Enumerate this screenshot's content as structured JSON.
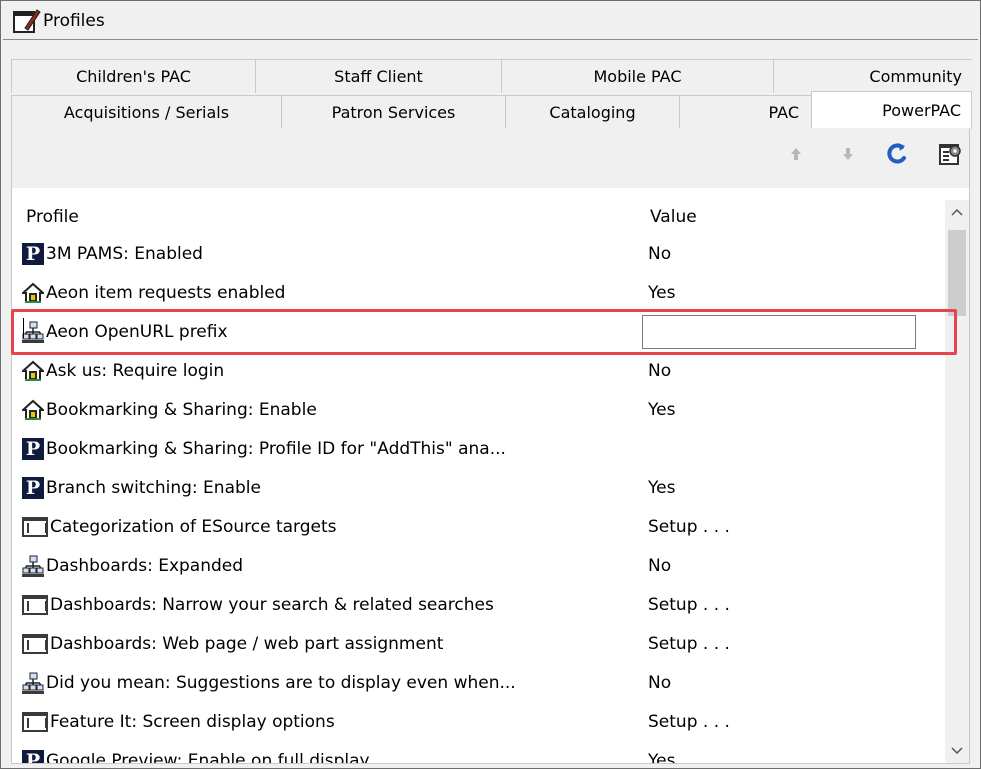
{
  "window": {
    "title": "Profiles"
  },
  "tabs": {
    "row1": [
      "Children's PAC",
      "Staff Client",
      "Mobile PAC",
      "Community"
    ],
    "row2": [
      "Acquisitions / Serials",
      "Patron Services",
      "Cataloging",
      "PAC",
      "PowerPAC"
    ],
    "active": "PowerPAC"
  },
  "toolbar": {
    "move_up": "arrow-up-icon",
    "move_down": "arrow-down-icon",
    "refresh": "refresh-icon",
    "properties": "properties-icon"
  },
  "grid": {
    "columns": {
      "profile": "Profile",
      "value": "Value"
    },
    "rows": [
      {
        "icon": "p-icon",
        "profile": "3M PAMS: Enabled",
        "value": "No"
      },
      {
        "icon": "house-icon",
        "profile": "Aeon item requests enabled",
        "value": "Yes"
      },
      {
        "icon": "network-icon",
        "profile": "Aeon OpenURL prefix",
        "value": "",
        "editing": true
      },
      {
        "icon": "house-icon",
        "profile": "Ask us: Require login",
        "value": "No"
      },
      {
        "icon": "house-icon",
        "profile": "Bookmarking & Sharing: Enable",
        "value": "Yes"
      },
      {
        "icon": "p-icon",
        "profile": "Bookmarking & Sharing: Profile ID for \"AddThis\" ana...",
        "value": ""
      },
      {
        "icon": "p-icon",
        "profile": "Branch switching: Enable",
        "value": "Yes"
      },
      {
        "icon": "folder-icon",
        "profile": "Categorization of ESource targets",
        "value": "Setup . . ."
      },
      {
        "icon": "network-icon",
        "profile": "Dashboards: Expanded",
        "value": "No"
      },
      {
        "icon": "folder-icon",
        "profile": "Dashboards: Narrow your search & related searches",
        "value": "Setup . . ."
      },
      {
        "icon": "folder-icon",
        "profile": "Dashboards: Web page / web part assignment",
        "value": "Setup . . ."
      },
      {
        "icon": "network-icon",
        "profile": "Did you mean: Suggestions are to display even when...",
        "value": "No"
      },
      {
        "icon": "folder-icon",
        "profile": "Feature It: Screen display options",
        "value": "Setup . . ."
      },
      {
        "icon": "p-icon",
        "profile": "Google Preview: Enable on full display",
        "value": "Yes"
      }
    ]
  },
  "colors": {
    "highlight": "#e8444c",
    "p_icon_bg": "#0f1a3c",
    "refresh_blue": "#1f5fbf"
  }
}
